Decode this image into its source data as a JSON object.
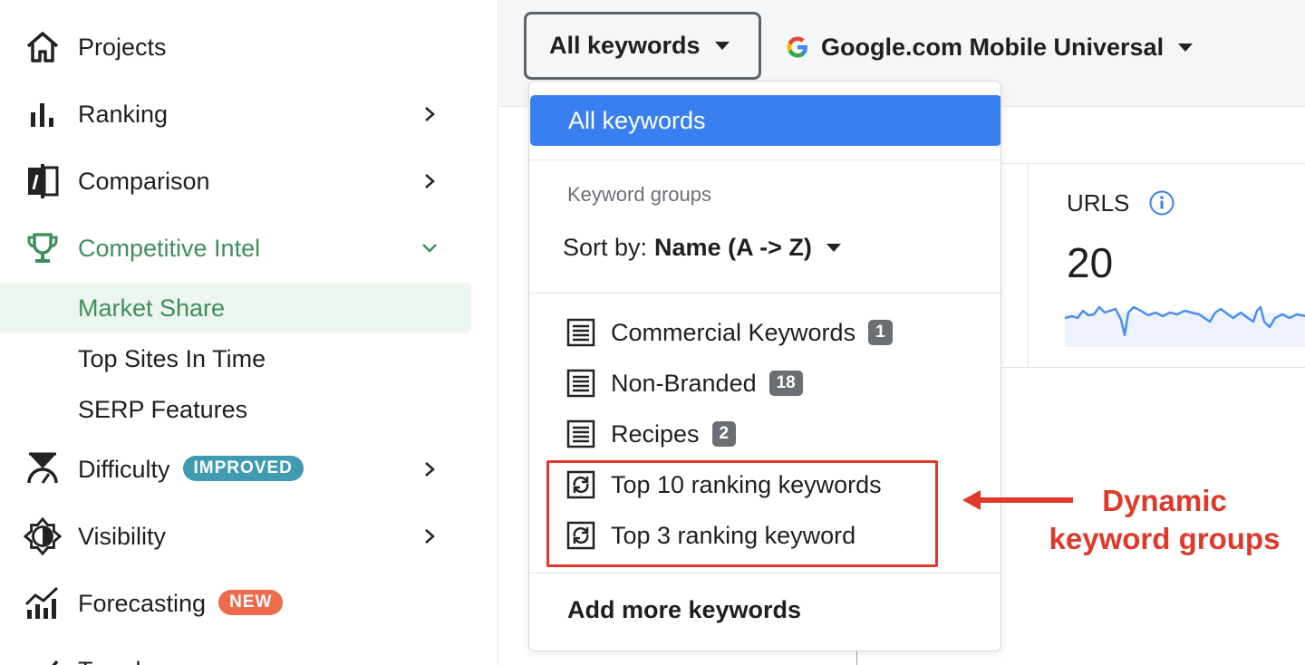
{
  "sidebar": {
    "items": [
      {
        "label": "Projects",
        "icon": "home-icon"
      },
      {
        "label": "Ranking",
        "icon": "bar-chart-icon"
      },
      {
        "label": "Comparison",
        "icon": "compare-icon"
      },
      {
        "label": "Competitive Intel",
        "icon": "trophy-icon"
      },
      {
        "label": "Difficulty",
        "icon": "scale-icon",
        "badge": "IMPROVED"
      },
      {
        "label": "Visibility",
        "icon": "visibility-icon"
      },
      {
        "label": "Forecasting",
        "icon": "forecast-icon",
        "badge": "NEW"
      },
      {
        "label": "Trends",
        "icon": "trends-icon"
      }
    ],
    "sub_items": [
      {
        "label": "Market Share"
      },
      {
        "label": "Top Sites In Time"
      },
      {
        "label": "SERP Features"
      }
    ]
  },
  "toolbar": {
    "keyword_select": "All keywords",
    "engine_select": "Google.com Mobile Universal"
  },
  "dropdown": {
    "all_keywords": "All keywords",
    "groups_label": "Keyword groups",
    "sort_prefix": "Sort by:",
    "sort_value": "Name (A -> Z)",
    "groups": [
      {
        "label": "Commercial Keywords",
        "count": "1",
        "icon": "document-icon"
      },
      {
        "label": "Non-Branded",
        "count": "18",
        "icon": "document-icon"
      },
      {
        "label": "Recipes",
        "count": "2",
        "icon": "document-icon"
      },
      {
        "label": "Top 10 ranking keywords",
        "icon": "dynamic-group-icon"
      },
      {
        "label": "Top 3 ranking keyword",
        "icon": "dynamic-group-icon"
      }
    ],
    "add_more": "Add more keywords"
  },
  "stats": {
    "urls_title": "URLS",
    "urls_value": "20"
  },
  "annotation": {
    "line1": "Dynamic",
    "line2": "keyword groups",
    "color": "#e0392b"
  },
  "colors": {
    "accent_green": "#3f8f5d",
    "dropdown_selected": "#3a7ff0",
    "badge_improved": "#3f9bb0",
    "badge_new": "#ee6b4d"
  }
}
